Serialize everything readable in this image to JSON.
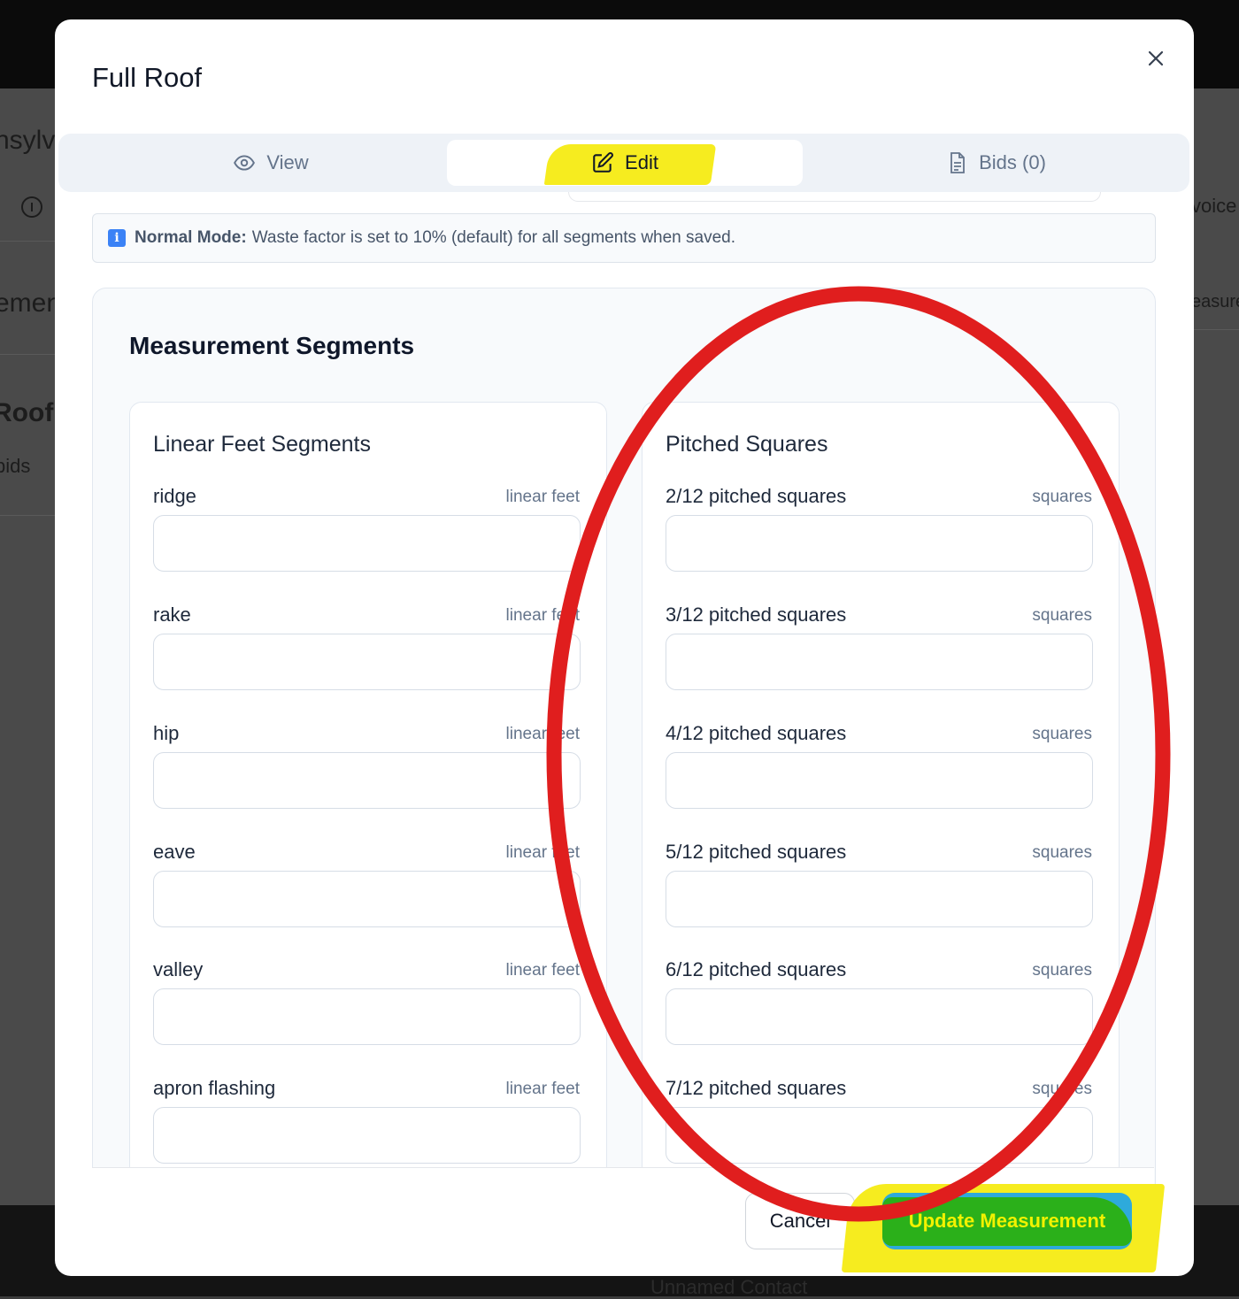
{
  "background": {
    "left_fragments": [
      "nsylv",
      "emen",
      "Roof",
      "bids"
    ],
    "right_fragments": [
      "voice",
      "easure"
    ],
    "footer_fragments": [
      "Unnamed Contact"
    ]
  },
  "modal": {
    "title": "Full Roof",
    "close_glyph": "×",
    "tabs": [
      {
        "label": "View",
        "icon": "eye-icon",
        "active": false
      },
      {
        "label": "Edit",
        "icon": "edit-icon",
        "active": true
      },
      {
        "label": "Bids (0)",
        "icon": "document-icon",
        "active": false
      }
    ],
    "notice": {
      "icon": "info-icon",
      "icon_glyph": "i",
      "mode_label": "Normal Mode:",
      "text": "Waste factor is set to 10% (default) for all segments when saved."
    },
    "segments": {
      "title": "Measurement Segments",
      "linear": {
        "title": "Linear Feet Segments",
        "fields": [
          {
            "label": "ridge",
            "unit": "linear feet",
            "value": ""
          },
          {
            "label": "rake",
            "unit": "linear feet",
            "value": ""
          },
          {
            "label": "hip",
            "unit": "linear feet",
            "value": ""
          },
          {
            "label": "eave",
            "unit": "linear feet",
            "value": ""
          },
          {
            "label": "valley",
            "unit": "linear feet",
            "value": ""
          },
          {
            "label": "apron flashing",
            "unit": "linear feet",
            "value": ""
          }
        ]
      },
      "pitched": {
        "title": "Pitched Squares",
        "fields": [
          {
            "label": "2/12 pitched squares",
            "unit": "squares",
            "value": ""
          },
          {
            "label": "3/12 pitched squares",
            "unit": "squares",
            "value": ""
          },
          {
            "label": "4/12 pitched squares",
            "unit": "squares",
            "value": ""
          },
          {
            "label": "5/12 pitched squares",
            "unit": "squares",
            "value": ""
          },
          {
            "label": "6/12 pitched squares",
            "unit": "squares",
            "value": ""
          },
          {
            "label": "7/12 pitched squares",
            "unit": "squares",
            "value": ""
          }
        ]
      }
    },
    "footer": {
      "cancel_label": "Cancel",
      "update_label": "Update Measurement"
    }
  },
  "annotations": {
    "ellipse_color": "#e01e1e",
    "highlight_color": "#f6ec1f"
  }
}
